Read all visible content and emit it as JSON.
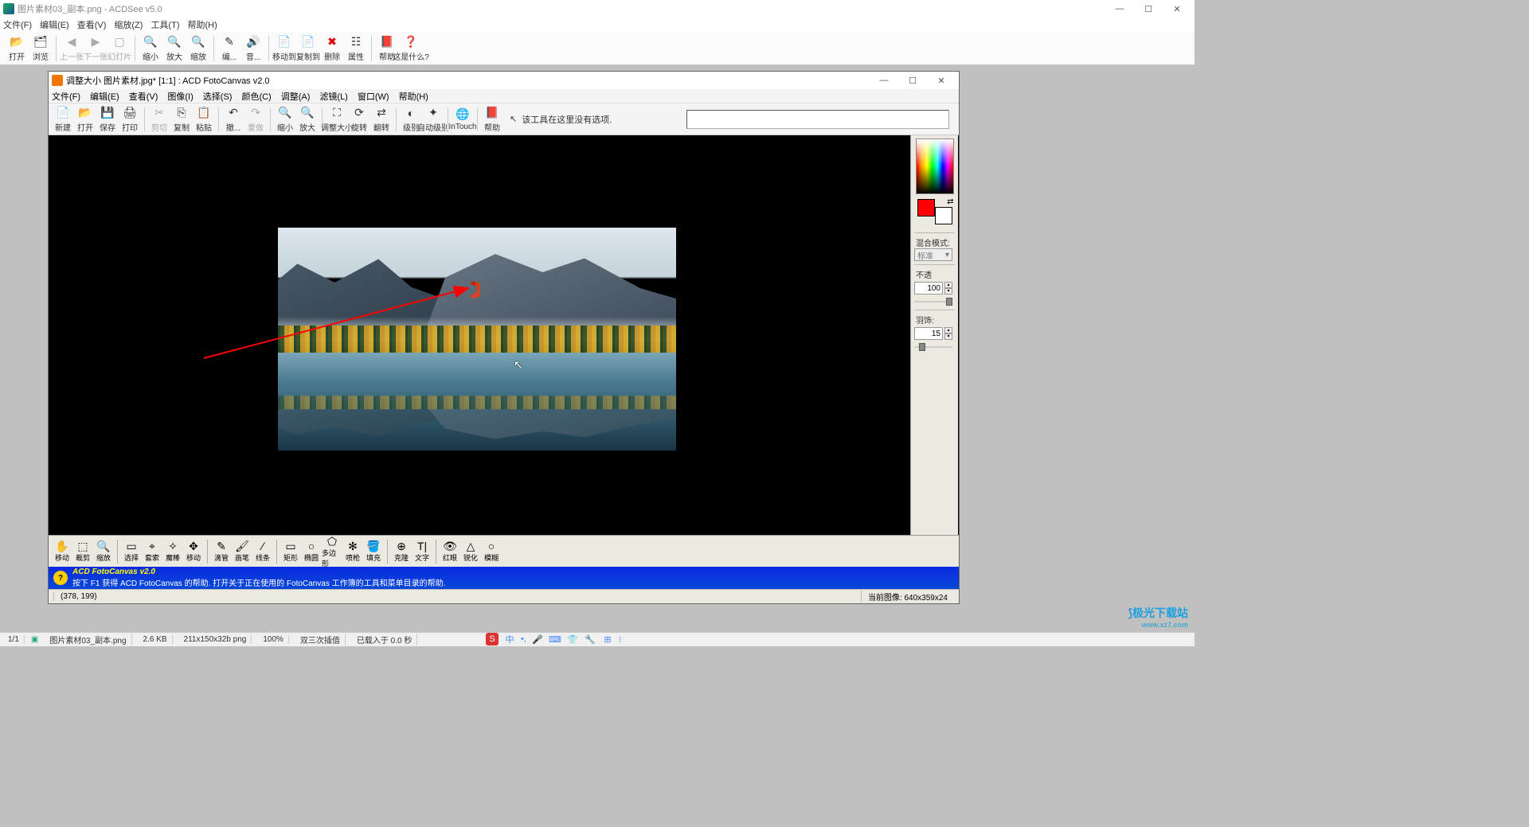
{
  "outer": {
    "title": "图片素材03_副本.png - ACDSee v5.0",
    "menu": [
      "文件(F)",
      "编辑(E)",
      "查看(V)",
      "缩放(Z)",
      "工具(T)",
      "帮助(H)"
    ],
    "win_controls": {
      "min": "—",
      "max": "☐",
      "close": "✕"
    },
    "toolbar": [
      {
        "label": "打开",
        "ico": "📂"
      },
      {
        "label": "浏览",
        "ico": "🗂"
      },
      {
        "sep": true
      },
      {
        "label": "上一张",
        "ico": "◀",
        "disabled": true
      },
      {
        "label": "下一张",
        "ico": "▶",
        "disabled": true
      },
      {
        "label": "幻灯片",
        "ico": "▢",
        "disabled": true
      },
      {
        "sep": true
      },
      {
        "label": "缩小",
        "ico": "🔍"
      },
      {
        "label": "放大",
        "ico": "🔍"
      },
      {
        "label": "缩放",
        "ico": "🔍"
      },
      {
        "sep": true
      },
      {
        "label": "编...",
        "ico": "✎"
      },
      {
        "label": "音...",
        "ico": "🔊"
      },
      {
        "sep": true
      },
      {
        "label": "移动到",
        "ico": "📄"
      },
      {
        "label": "复制到",
        "ico": "📄"
      },
      {
        "label": "删除",
        "ico": "✖",
        "color": "#d00"
      },
      {
        "label": "属性",
        "ico": "☷"
      },
      {
        "sep": true
      },
      {
        "label": "帮助",
        "ico": "📕"
      },
      {
        "label": "这是什么?",
        "ico": "❓"
      }
    ]
  },
  "inner": {
    "title": "调整大小 图片素材.jpg* [1:1] : ACD FotoCanvas v2.0",
    "menu": [
      "文件(F)",
      "编辑(E)",
      "查看(V)",
      "图像(I)",
      "选择(S)",
      "颜色(C)",
      "调整(A)",
      "滤镜(L)",
      "窗口(W)",
      "帮助(H)"
    ],
    "toolbar": [
      {
        "label": "新建",
        "ico": "📄"
      },
      {
        "label": "打开",
        "ico": "📂"
      },
      {
        "label": "保存",
        "ico": "💾"
      },
      {
        "label": "打印",
        "ico": "🖨"
      },
      {
        "sep": true
      },
      {
        "label": "剪切",
        "ico": "✂",
        "disabled": true
      },
      {
        "label": "复制",
        "ico": "⎘"
      },
      {
        "label": "粘贴",
        "ico": "📋"
      },
      {
        "sep": true
      },
      {
        "label": "撤...",
        "ico": "↶"
      },
      {
        "label": "重做",
        "ico": "↷",
        "disabled": true
      },
      {
        "sep": true
      },
      {
        "label": "缩小",
        "ico": "🔍"
      },
      {
        "label": "放大",
        "ico": "🔍"
      },
      {
        "sep": true
      },
      {
        "label": "调整大小",
        "ico": "⛶"
      },
      {
        "label": "旋转",
        "ico": "⟳"
      },
      {
        "label": "翻转",
        "ico": "⇄"
      },
      {
        "sep": true
      },
      {
        "label": "级别",
        "ico": "◐"
      },
      {
        "label": "自动级别",
        "ico": "✦"
      },
      {
        "sep": true
      },
      {
        "label": "InTouch",
        "ico": "🌐"
      },
      {
        "sep": true
      },
      {
        "label": "帮助",
        "ico": "📕"
      }
    ],
    "tool_info": "该工具在这里没有选项.",
    "side": {
      "blend_label": "混合模式:",
      "blend_value": "标准",
      "opacity_label": "不透",
      "opacity_value": "100",
      "feather_label": "羽饰:",
      "feather_value": "15"
    },
    "tools_bottom": [
      {
        "label": "移动",
        "ico": "✋"
      },
      {
        "label": "裁剪",
        "ico": "⬚"
      },
      {
        "label": "缩放",
        "ico": "🔍"
      },
      {
        "sep": true
      },
      {
        "label": "选择",
        "ico": "▭"
      },
      {
        "label": "套索",
        "ico": "⌖"
      },
      {
        "label": "魔棒",
        "ico": "✧"
      },
      {
        "label": "移动",
        "ico": "✥"
      },
      {
        "sep": true
      },
      {
        "label": "滴管",
        "ico": "✎"
      },
      {
        "label": "画笔",
        "ico": "🖌"
      },
      {
        "label": "线条",
        "ico": "∕"
      },
      {
        "sep": true
      },
      {
        "label": "矩形",
        "ico": "▭"
      },
      {
        "label": "椭圆",
        "ico": "○"
      },
      {
        "label": "多边形",
        "ico": "⬠"
      },
      {
        "label": "喷枪",
        "ico": "✻"
      },
      {
        "label": "填充",
        "ico": "🪣"
      },
      {
        "sep": true
      },
      {
        "label": "克隆",
        "ico": "⊕"
      },
      {
        "label": "文字",
        "ico": "T|"
      },
      {
        "sep": true
      },
      {
        "label": "红眼",
        "ico": "👁"
      },
      {
        "label": "锐化",
        "ico": "△"
      },
      {
        "label": "模糊",
        "ico": "○"
      }
    ],
    "blue_bar": {
      "title": "ACD FotoCanvas v2.0",
      "text": "按下 F1 获得 ACD FotoCanvas 的帮助. 打开关于正在使用的 FotoCanvas 工作簿的工具和菜单目录的帮助."
    },
    "status": {
      "coords": "(378, 199)",
      "right": "当前图像: 640x359x24"
    }
  },
  "outer_status": {
    "page": "1/1",
    "file": "图片素材03_副本.png",
    "size": "2.6 KB",
    "dim": "211x150x32b png",
    "zoom": "100%",
    "interp": "双三次插值",
    "load": "已载入于 0.0 秒"
  },
  "watermark": {
    "brand": "极光下载站",
    "url": "www.xz7.com"
  }
}
